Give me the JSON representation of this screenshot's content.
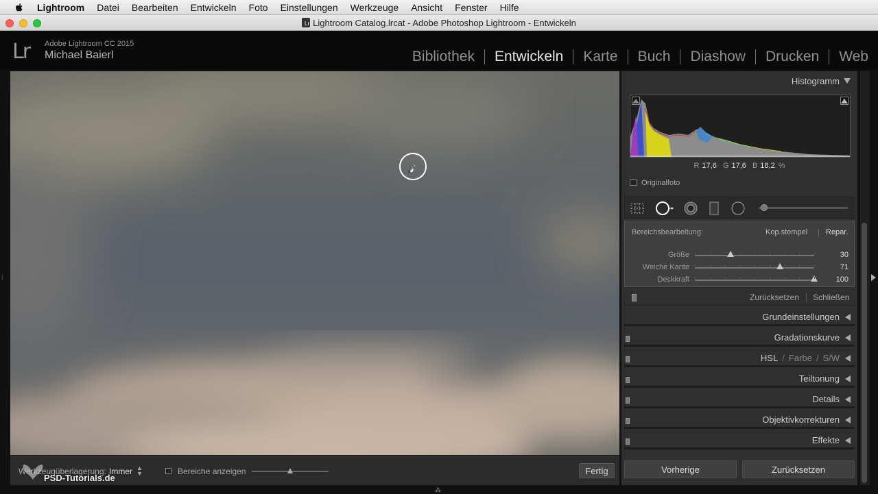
{
  "menubar": {
    "app": "Lightroom",
    "items": [
      "Datei",
      "Bearbeiten",
      "Entwickeln",
      "Foto",
      "Einstellungen",
      "Werkzeuge",
      "Ansicht",
      "Fenster",
      "Hilfe"
    ]
  },
  "window": {
    "doc_icon": "Lr",
    "title": "Lightroom Catalog.lrcat - Adobe Photoshop Lightroom - Entwickeln"
  },
  "identity": {
    "logo": "Lr",
    "product": "Adobe Lightroom CC 2015",
    "user": "Michael Baierl"
  },
  "modules": [
    "Bibliothek",
    "Entwickeln",
    "Karte",
    "Buch",
    "Diashow",
    "Drucken",
    "Web"
  ],
  "active_module": "Entwickeln",
  "histogram": {
    "title": "Histogramm",
    "r_label": "R",
    "r_value": "17,6",
    "g_label": "G",
    "g_value": "17,6",
    "b_label": "B",
    "b_value": "18,2",
    "unit": "%",
    "original_label": "Originalfoto"
  },
  "spot_removal": {
    "label": "Bereichsbearbeitung:",
    "clone_label": "Kop.stempel",
    "heal_label": "Repar.",
    "sliders": [
      {
        "label": "Größe",
        "value": "30",
        "level": 0.3
      },
      {
        "label": "Weiche Kante",
        "value": "71",
        "level": 0.71
      },
      {
        "label": "Deckkraft",
        "value": "100",
        "level": 1.0
      }
    ],
    "reset_label": "Zurücksetzen",
    "close_label": "Schließen"
  },
  "sections": [
    {
      "name": "Grundeinstellungen",
      "switch": false
    },
    {
      "name": "Gradationskurve",
      "switch": true
    },
    {
      "name": "HSL",
      "extra1": "Farbe",
      "extra2": "S/W",
      "switch": true
    },
    {
      "name": "Teiltonung",
      "switch": true
    },
    {
      "name": "Details",
      "switch": true
    },
    {
      "name": "Objektivkorrekturen",
      "switch": true
    },
    {
      "name": "Effekte",
      "switch": true
    }
  ],
  "hsl_sep": "/",
  "bottom_buttons": {
    "previous": "Vorherige",
    "reset": "Zurücksetzen"
  },
  "toolbar": {
    "overlay_label": "Werkzeugüberlagerung:",
    "overlay_value": "Immer",
    "areas_label": "Bereiche anzeigen",
    "done_label": "Fertig",
    "areas_level": 0.5
  },
  "watermark": {
    "text": "PSD-Tutorials.de"
  },
  "colors": {
    "panel_bg": "#2f2f2f",
    "active_module": "#e6e6e6",
    "inactive_module": "#909090"
  }
}
